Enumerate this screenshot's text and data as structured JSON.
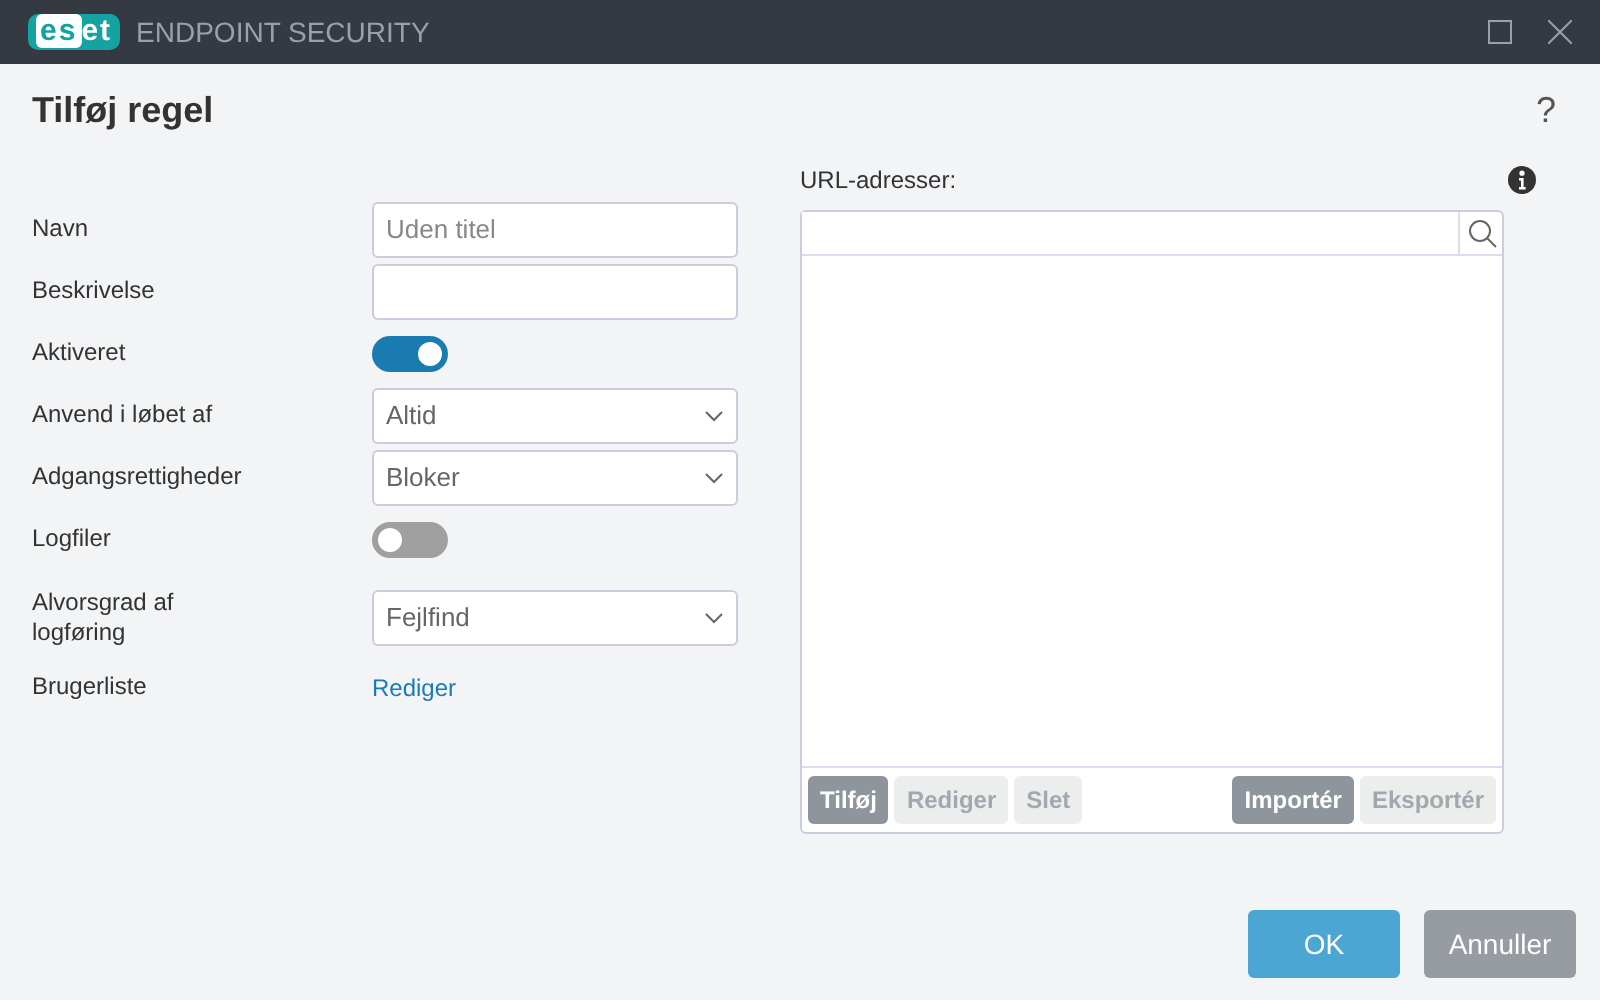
{
  "window": {
    "logo": "eset",
    "product": "ENDPOINT SECURITY"
  },
  "dialog": {
    "title": "Tilføj regel",
    "help": "?"
  },
  "fields": [
    {
      "kind": "text",
      "label": "Navn",
      "placeholder": "Uden titel"
    },
    {
      "kind": "text",
      "label": "Beskrivelse"
    },
    {
      "kind": "toggle",
      "label": "Aktiveret",
      "on": true
    },
    {
      "kind": "select",
      "label": "Anvend i løbet af",
      "value": "Altid"
    },
    {
      "kind": "select",
      "label": "Adgangsrettigheder",
      "value": "Bloker"
    },
    {
      "kind": "toggle",
      "label": "Logfiler",
      "on": false
    },
    {
      "kind": "select",
      "label": "Alvorsgrad af logføring",
      "value": "Fejlfind"
    },
    {
      "kind": "link",
      "label": "Brugerliste",
      "value": "Rediger"
    }
  ],
  "url_list": {
    "label": "URL-adresser:",
    "buttons": [
      {
        "label": "Tilføj",
        "disabled": false
      },
      {
        "label": "Rediger",
        "disabled": true
      },
      {
        "label": "Slet",
        "disabled": true
      },
      {
        "label": "Importér",
        "disabled": false
      },
      {
        "label": "Eksportér",
        "disabled": true
      }
    ]
  },
  "footer": {
    "ok": "OK",
    "cancel": "Annuller"
  }
}
